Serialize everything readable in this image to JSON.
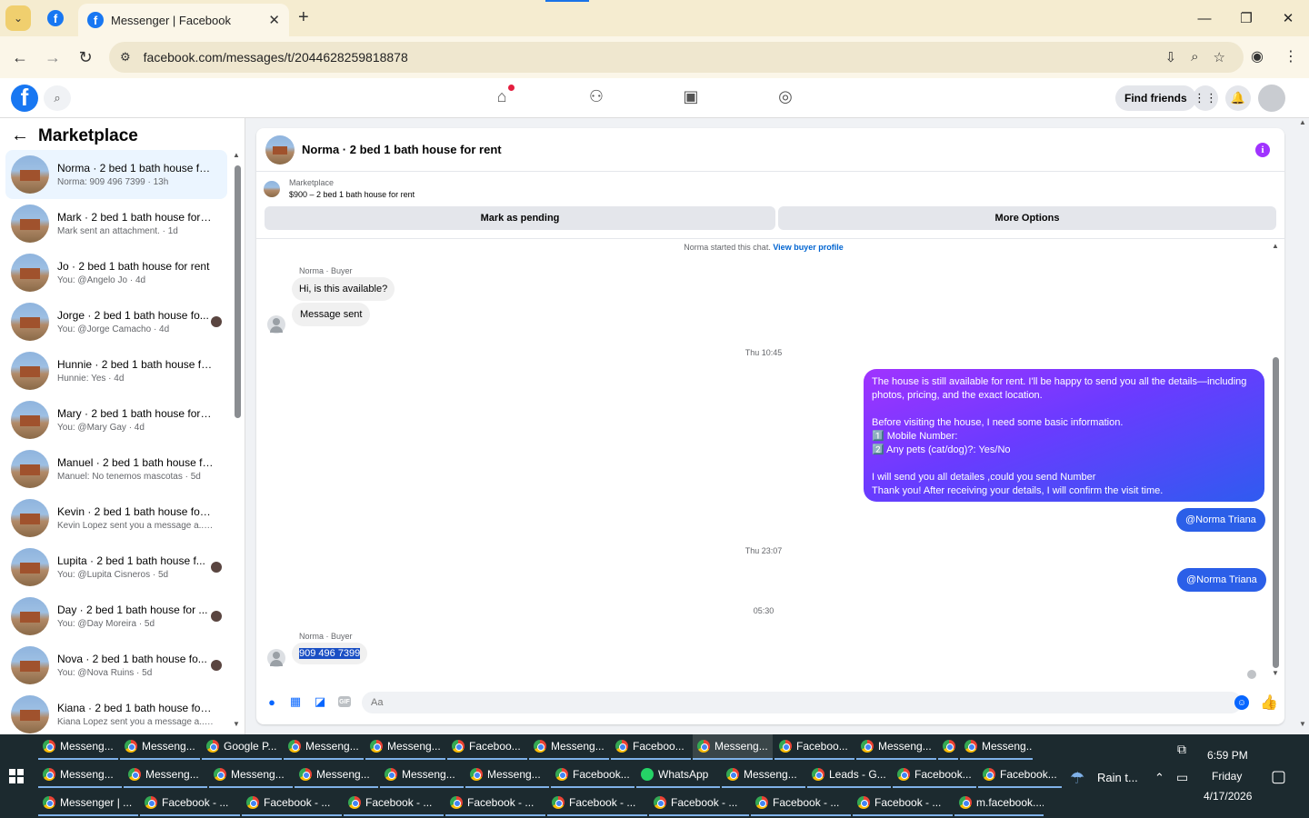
{
  "browser": {
    "tab_title": "Messenger | Facebook",
    "url": "facebook.com/messages/t/2044628259818878"
  },
  "header": {
    "find_friends": "Find friends"
  },
  "sidebar": {
    "title": "Marketplace",
    "conversations": [
      {
        "title": "Norma · 2 bed 1 bath house for ...",
        "sub": "Norma: 909 496 7399 · 13h",
        "active": true
      },
      {
        "title": "Mark · 2 bed 1 bath house for r...",
        "sub": "Mark sent an attachment. · 1d"
      },
      {
        "title": "Jo · 2 bed 1 bath house for rent",
        "sub": "You: @Angelo Jo · 4d"
      },
      {
        "title": "Jorge · 2 bed 1 bath house fo...",
        "sub": "You: @Jorge Camacho · 4d",
        "seen": true
      },
      {
        "title": "Hunnie · 2 bed 1 bath house for...",
        "sub": "Hunnie: Yes · 4d"
      },
      {
        "title": "Mary · 2 bed 1 bath house for r...",
        "sub": "You: @Mary Gay · 4d"
      },
      {
        "title": "Manuel · 2 bed 1 bath house for...",
        "sub": "Manuel: No tenemos mascotas · 5d"
      },
      {
        "title": "Kevin · 2 bed 1 bath house for r...",
        "sub": "Kevin Lopez sent you a message a... · 5d"
      },
      {
        "title": "Lupita · 2 bed 1 bath house f...",
        "sub": "You: @Lupita Cisneros · 5d",
        "seen": true
      },
      {
        "title": "Day · 2 bed 1 bath house for ...",
        "sub": "You: @Day Moreira · 5d",
        "seen": true
      },
      {
        "title": "Nova · 2 bed 1 bath house fo...",
        "sub": "You: @Nova Ruins · 5d",
        "seen": true
      },
      {
        "title": "Kiana · 2 bed 1 bath house for r...",
        "sub": "Kiana Lopez sent you a message a... · 5d"
      }
    ]
  },
  "chat": {
    "title": "Norma · 2 bed 1 bath house for rent",
    "listing_label": "Marketplace",
    "listing_price": "$900 – 2 bed 1 bath house for rent",
    "mark_pending": "Mark as pending",
    "more_options": "More Options",
    "started_text": "Norma started this chat.",
    "view_profile": "View buyer profile",
    "sender_label": "Norma · Buyer",
    "msg1": "Hi, is this available?",
    "msg2": "Message sent",
    "ts1": "Thu 10:45",
    "out_msg": "The house is still available for rent. I'll be happy to send you all the details—including\nphotos, pricing, and the exact location.\n\nBefore visiting the house, I need some basic information.\n1️⃣  Mobile Number:\n2️⃣ Any pets (cat/dog)?: Yes/No\n\nI will send you all detailes ,could you send Number\nThank you! After receiving your details, I will confirm the visit time.",
    "mention1": "@Norma Triana",
    "ts2": "Thu 23:07",
    "mention2": "@Norma Triana",
    "ts3": "05:30",
    "sender_label2": "Norma · Buyer",
    "phone": "909 496 7399",
    "input_placeholder": "Aa"
  },
  "taskbar": {
    "row1": [
      {
        "label": "Messeng...",
        "icon": "chrome"
      },
      {
        "label": "Messeng...",
        "icon": "chrome"
      },
      {
        "label": "Google P...",
        "icon": "chrome"
      },
      {
        "label": "Messeng...",
        "icon": "chrome"
      },
      {
        "label": "Messeng...",
        "icon": "chrome"
      },
      {
        "label": "Faceboo...",
        "icon": "chrome"
      },
      {
        "label": "Messeng...",
        "icon": "chrome"
      },
      {
        "label": "Faceboo...",
        "icon": "chrome"
      },
      {
        "label": "Messeng...",
        "icon": "chrome",
        "selected": true
      },
      {
        "label": "Faceboo...",
        "icon": "chrome"
      },
      {
        "label": "Messeng...",
        "icon": "chrome"
      },
      {
        "label": "",
        "icon": "chrome"
      },
      {
        "label": "Messeng...",
        "icon": "chrome"
      }
    ],
    "row2": [
      {
        "label": "Messeng...",
        "icon": "chrome"
      },
      {
        "label": "Messeng...",
        "icon": "chrome"
      },
      {
        "label": "Messeng...",
        "icon": "chrome"
      },
      {
        "label": "Messeng...",
        "icon": "chrome"
      },
      {
        "label": "Messeng...",
        "icon": "chrome"
      },
      {
        "label": "Messeng...",
        "icon": "chrome"
      },
      {
        "label": "Facebook...",
        "icon": "chrome"
      },
      {
        "label": "WhatsApp",
        "icon": "whatsapp"
      },
      {
        "label": "Messeng...",
        "icon": "chrome"
      },
      {
        "label": "Leads - G...",
        "icon": "chrome"
      },
      {
        "label": "Facebook...",
        "icon": "chrome"
      },
      {
        "label": "Facebook...",
        "icon": "chrome"
      }
    ],
    "row3": [
      {
        "label": "Messenger | ...",
        "icon": "chrome"
      },
      {
        "label": "Facebook - ...",
        "icon": "chrome"
      },
      {
        "label": "Facebook - ...",
        "icon": "chrome"
      },
      {
        "label": "Facebook - ...",
        "icon": "chrome"
      },
      {
        "label": "Facebook - ...",
        "icon": "chrome"
      },
      {
        "label": "Facebook - ...",
        "icon": "chrome"
      },
      {
        "label": "Facebook - ...",
        "icon": "chrome"
      },
      {
        "label": "Facebook - ...",
        "icon": "chrome"
      },
      {
        "label": "Facebook - ...",
        "icon": "chrome"
      },
      {
        "label": "m.facebook....",
        "icon": "chrome"
      }
    ],
    "weather": "Rain t...",
    "time": "6:59 PM",
    "day": "Friday",
    "date": "4/17/2026"
  }
}
